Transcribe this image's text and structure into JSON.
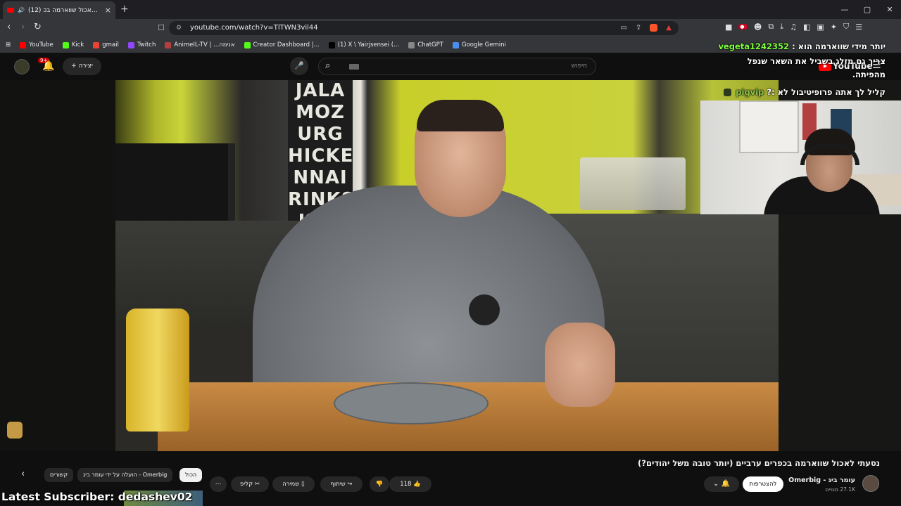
{
  "browser": {
    "tab_title": "(12) נסעתי לאכול שווארמה בכ",
    "tab_close": "×",
    "new_tab": "+",
    "url": "youtube.com/watch?v=TlTWN3vil44",
    "window_controls": [
      "—",
      "▢",
      "✕"
    ]
  },
  "bookmarks": [
    {
      "label": "YouTube",
      "color": "#ff0000"
    },
    {
      "label": "Kick",
      "color": "#53fc18"
    },
    {
      "label": "gmail",
      "color": "#ea4335"
    },
    {
      "label": "Twitch",
      "color": "#9146ff"
    },
    {
      "label": "AnimeIL-TV | ...אנימה",
      "color": "#b04040"
    },
    {
      "label": "Creator Dashboard |...",
      "color": "#53fc18"
    },
    {
      "label": "(1) X \\ Yairjsensei (...",
      "color": "#000000"
    },
    {
      "label": "ChatGPT",
      "color": "#888888"
    },
    {
      "label": "Google Gemini",
      "color": "#4a8ef0"
    }
  ],
  "youtube": {
    "create_label": "+ יצירה",
    "notif_count": "9+",
    "search_placeholder": "חיפוש",
    "logo_text": "YouTube"
  },
  "video_sign_text": "JALA\nMOZ\nURG\nHICKE\nNNAI\nRINKS\nKEN",
  "chat": [
    {
      "user": "vegeta1242352",
      "text": "יותר מידי שווארמה הוא :"
    },
    {
      "user": "",
      "text": "צריך גם מזלג בשביל את השאר שנפל"
    },
    {
      "user": "",
      "text": "מהפיתה."
    },
    {
      "user": "pigvip",
      "text": "קליל לך אתה פרופיטיבול לא :?"
    }
  ],
  "video": {
    "title": "נסעתי לאכול שווארמה בכפרים ערביים (יותר טובה משל יהודים?)",
    "channel": "עומר ביג - Omerbig",
    "subscribers": "27.1K מנויים",
    "join_label": "להצטרפות",
    "likes": "118",
    "share_label": "שיתוף",
    "save_label": "שמירה",
    "clip_label": "קליפ"
  },
  "chips": [
    "הכול",
    "הועלה על ידי עומר ביג - Omerbig",
    "קשורים"
  ],
  "overlay": {
    "latest_subscriber": "Latest Subscriber: dedashev02"
  },
  "colors": {
    "accent_red": "#ff0000",
    "chat_user_green": "#7fff3c"
  }
}
